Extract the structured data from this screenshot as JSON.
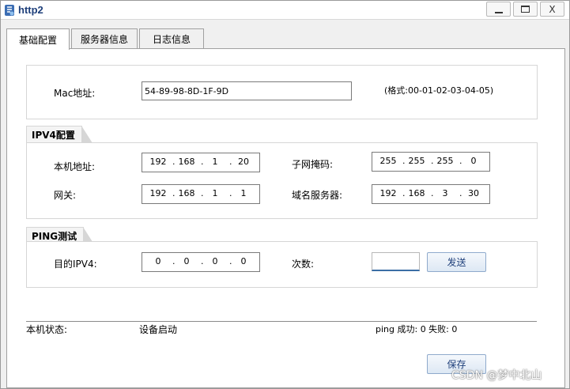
{
  "window": {
    "title": "http2",
    "controls": {
      "minimize": "",
      "maximize": "",
      "close": "X"
    }
  },
  "tabs": [
    {
      "label": "基础配置",
      "active": true
    },
    {
      "label": "服务器信息",
      "active": false
    },
    {
      "label": "日志信息",
      "active": false
    }
  ],
  "mac": {
    "label": "Mac地址:",
    "value": "54-89-98-8D-1F-9D",
    "format_hint": "(格式:00-01-02-03-04-05)"
  },
  "ipv4": {
    "title": "IPV4配置",
    "local_ip": {
      "label": "本机地址:",
      "octets": [
        "192",
        "168",
        "1",
        "20"
      ]
    },
    "subnet": {
      "label": "子网掩码:",
      "octets": [
        "255",
        "255",
        "255",
        "0"
      ]
    },
    "gateway": {
      "label": "网关:",
      "octets": [
        "192",
        "168",
        "1",
        "1"
      ]
    },
    "dns": {
      "label": "域名服务器:",
      "octets": [
        "192",
        "168",
        "3",
        "30"
      ]
    }
  },
  "ping": {
    "title": "PING测试",
    "target": {
      "label": "目的IPV4:",
      "octets": [
        "0",
        "0",
        "0",
        "0"
      ]
    },
    "count": {
      "label": "次数:",
      "value": ""
    },
    "send_label": "发送"
  },
  "status": {
    "label": "本机状态:",
    "value": "设备启动",
    "ping_result": "ping 成功: 0 失败: 0"
  },
  "save_label": "保存",
  "watermark": "CSDN @梦中北山",
  "colors": {
    "title_text": "#1e3f7a",
    "button_border": "#8faacc",
    "focus_underline": "#3b6ea5"
  }
}
